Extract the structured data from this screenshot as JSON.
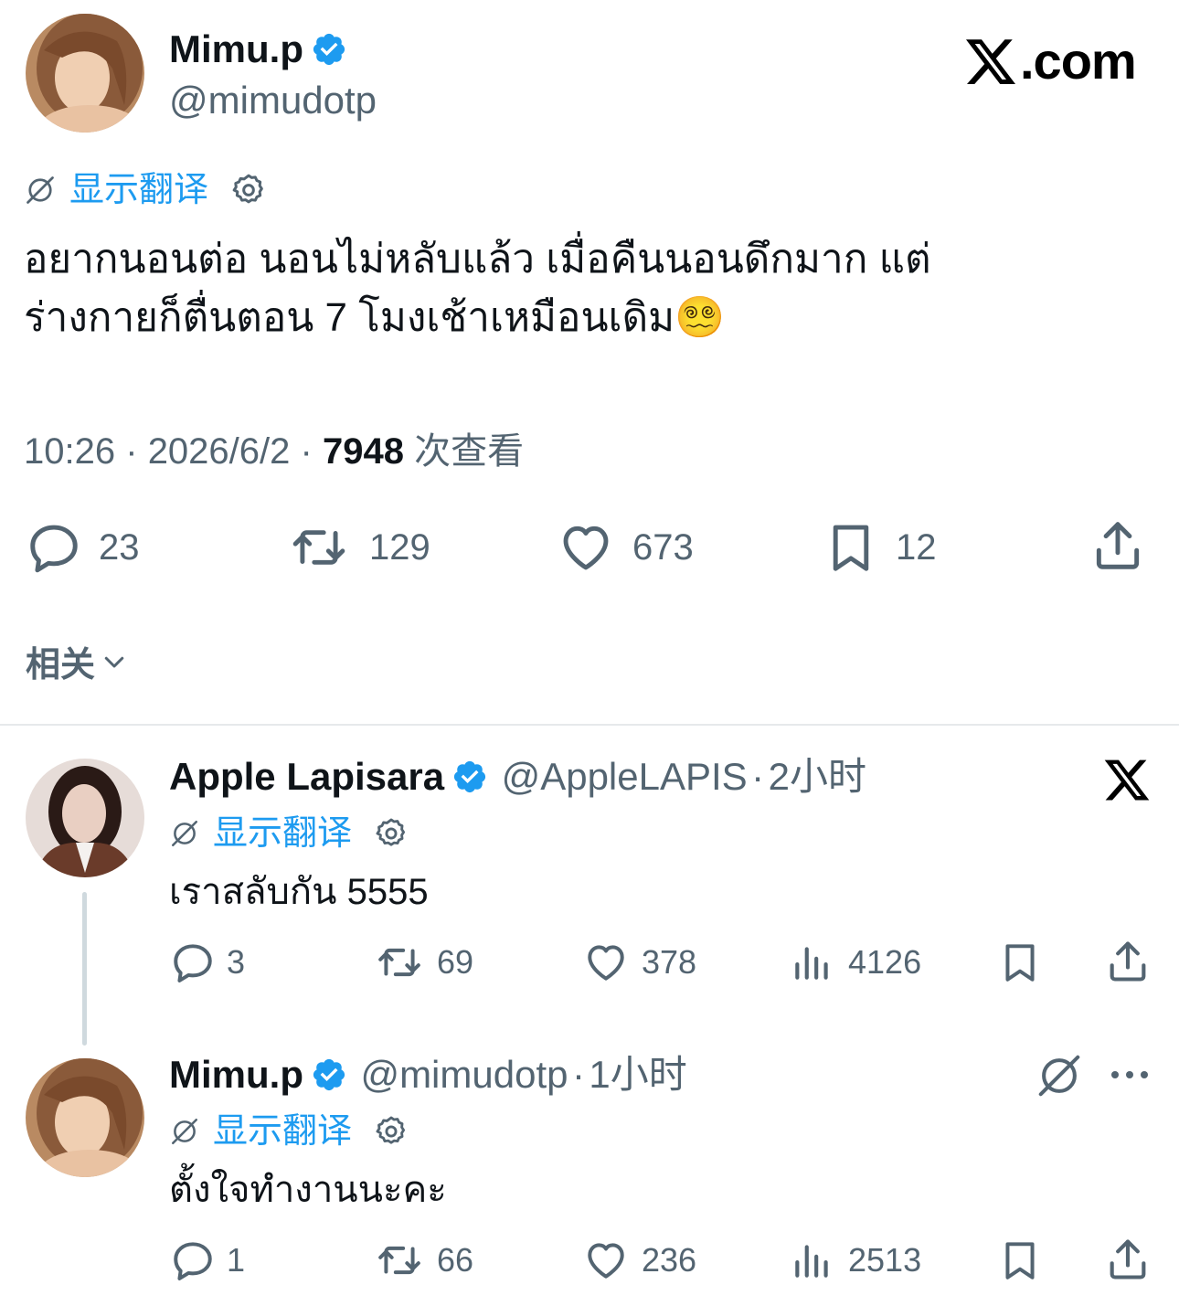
{
  "main_post": {
    "author_name": "Mimu.p",
    "author_handle": "@mimudotp",
    "site_label": ".com",
    "translate_label": "显示翻译",
    "text_line1": "อยากนอนต่อ นอนไม่หลับแล้ว เมื่อคืนนอนดึกมาก แต่",
    "text_line2": "ร่างกายก็ตื่นตอน 7 โมงเช้าเหมือนเดิม",
    "emoji": "😵‍💫",
    "time": "10:26",
    "date": "2026/6/2",
    "views_count": "7948",
    "views_label": "次查看",
    "separator": "·",
    "replies": "23",
    "reposts": "129",
    "likes": "673",
    "bookmarks": "12"
  },
  "related_label": "相关",
  "replies": [
    {
      "author_name": "Apple Lapisara",
      "author_handle": "@AppleLAPIS",
      "time": "2小时",
      "translate_label": "显示翻译",
      "text": "เราสลับกัน 5555",
      "replies": "3",
      "reposts": "69",
      "likes": "378",
      "views": "4126"
    },
    {
      "author_name": "Mimu.p",
      "author_handle": "@mimudotp",
      "time": "1小时",
      "translate_label": "显示翻译",
      "text": "ตั้งใจทำงานนะคะ",
      "replies": "1",
      "reposts": "66",
      "likes": "236",
      "views": "2513"
    }
  ],
  "colors": {
    "accent": "#1d9bf0",
    "text": "#0f1419",
    "muted": "#536471",
    "divider": "#e6e9eb"
  }
}
